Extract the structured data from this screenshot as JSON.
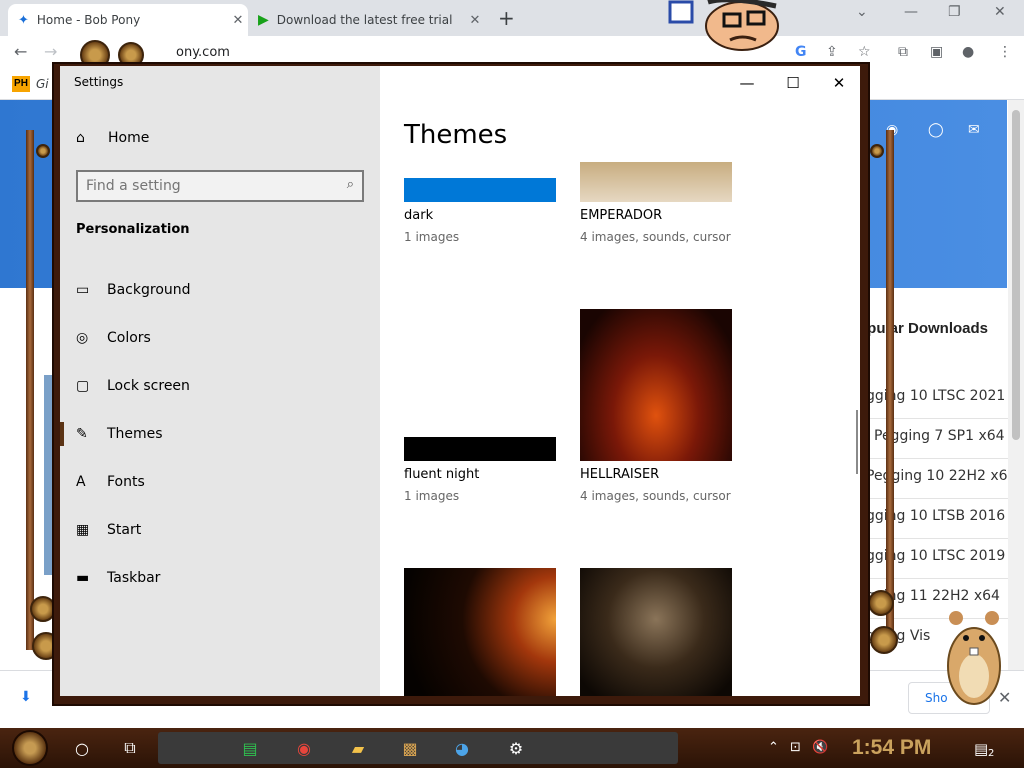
{
  "browser": {
    "tabs": [
      {
        "title": "Home - Bob Pony",
        "close": "✕"
      },
      {
        "title": "Download the latest free trial",
        "close": "✕"
      }
    ],
    "new_tab": "+",
    "window_controls": {
      "minimize": "—",
      "restore": "❐",
      "close": "✕"
    },
    "nav": {
      "back": "←",
      "forward": "→"
    },
    "url": "ony.com",
    "omnibox_icons": {
      "google": "G",
      "share": "⇪",
      "star": "☆",
      "extensions": "⧉",
      "sidepanel": "▣",
      "profile": "●",
      "menu": "⋮"
    },
    "bookmark_badge": "PH",
    "bookmark_text": "Gi",
    "social": {
      "discord": "◉",
      "github": "◯",
      "mail": "✉"
    },
    "popular": {
      "title": "opular Downloads",
      "items": [
        "gging 10 LTSC 2021",
        "Pegging 7 SP1 x64",
        "Pegging 10 22H2 x64",
        "gging 10 LTSB 2016",
        "gging 10 LTSC 2019",
        "gging 11 22H2 x64",
        "gging Vis"
      ]
    },
    "download_bar": {
      "file_icon": "⬇",
      "show_all": "Sho",
      "close": "✕"
    }
  },
  "settings": {
    "window_title": "Settings",
    "caption": {
      "minimize": "—",
      "maximize": "☐",
      "close": "✕"
    },
    "home": {
      "label": "Home",
      "icon": "⌂"
    },
    "search": {
      "placeholder": "Find a setting",
      "icon": "⌕"
    },
    "section": "Personalization",
    "nav_items": [
      {
        "label": "Background",
        "icon": "▭"
      },
      {
        "label": "Colors",
        "icon": "◎"
      },
      {
        "label": "Lock screen",
        "icon": "▢"
      },
      {
        "label": "Themes",
        "icon": "✎"
      },
      {
        "label": "Fonts",
        "icon": "A"
      },
      {
        "label": "Start",
        "icon": "▦"
      },
      {
        "label": "Taskbar",
        "icon": "▬"
      }
    ],
    "selected_nav": "Themes",
    "main_heading": "Themes",
    "themes": [
      {
        "name": "dark",
        "meta": "1 images",
        "color": "#0078d7"
      },
      {
        "name": "EMPERADOR",
        "meta": "4 images, sounds, cursor",
        "color": "#d8c6a8"
      },
      {
        "name": "fluent night",
        "meta": "1 images",
        "color": "#000000"
      },
      {
        "name": "HELLRAISER",
        "meta": "4 images, sounds, cursor",
        "color": "#7a1808"
      },
      {
        "name": "",
        "meta": "",
        "color": "#2b1000"
      },
      {
        "name": "",
        "meta": "",
        "color": "#3a2a1a"
      }
    ]
  },
  "taskbar": {
    "cortana": "○",
    "task_view": "⧉",
    "apps": [
      {
        "name": "app-green",
        "glyph": "▤",
        "color": "#2fbf4f"
      },
      {
        "name": "chrome",
        "glyph": "◉",
        "color": "#e8453c"
      },
      {
        "name": "explorer",
        "glyph": "▰",
        "color": "#f3c24a"
      },
      {
        "name": "photo-app",
        "glyph": "▩",
        "color": "#d8a350"
      },
      {
        "name": "network-app",
        "glyph": "◕",
        "color": "#4ca4e8"
      },
      {
        "name": "settings",
        "glyph": "⚙",
        "color": "#ffffff"
      }
    ],
    "tray": {
      "chevron": "⌃",
      "network": "⊡",
      "volume": "🔇"
    },
    "clock": "1:54 PM",
    "notifications": {
      "icon": "▤",
      "count": "2"
    }
  }
}
